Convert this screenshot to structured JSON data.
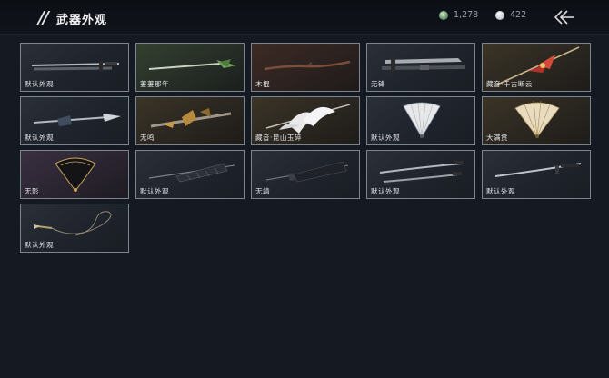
{
  "header": {
    "title": "武器外观",
    "jade_amount": "1,278",
    "pearl_amount": "422"
  },
  "items": [
    {
      "label": "默认外观",
      "icon": "long-sword"
    },
    {
      "label": "萋萋那年",
      "icon": "jade-sword"
    },
    {
      "label": "木棍",
      "icon": "wooden-staff"
    },
    {
      "label": "无锋",
      "icon": "broad-sword"
    },
    {
      "label": "藏音·千古断云",
      "icon": "red-spear"
    },
    {
      "label": "默认外观",
      "icon": "ornate-sword"
    },
    {
      "label": "无鸣",
      "icon": "golden-blade"
    },
    {
      "label": "藏音·昆山玉碎",
      "icon": "winged-spear"
    },
    {
      "label": "默认外观",
      "icon": "white-fan"
    },
    {
      "label": "大满贯",
      "icon": "gold-fan"
    },
    {
      "label": "无影",
      "icon": "black-fan"
    },
    {
      "label": "默认外观",
      "icon": "umbrella"
    },
    {
      "label": "无靖",
      "icon": "dark-umbrella"
    },
    {
      "label": "默认外观",
      "icon": "dual-sabers"
    },
    {
      "label": "默认外观",
      "icon": "katana"
    },
    {
      "label": "默认外观",
      "icon": "rope-dart"
    }
  ]
}
